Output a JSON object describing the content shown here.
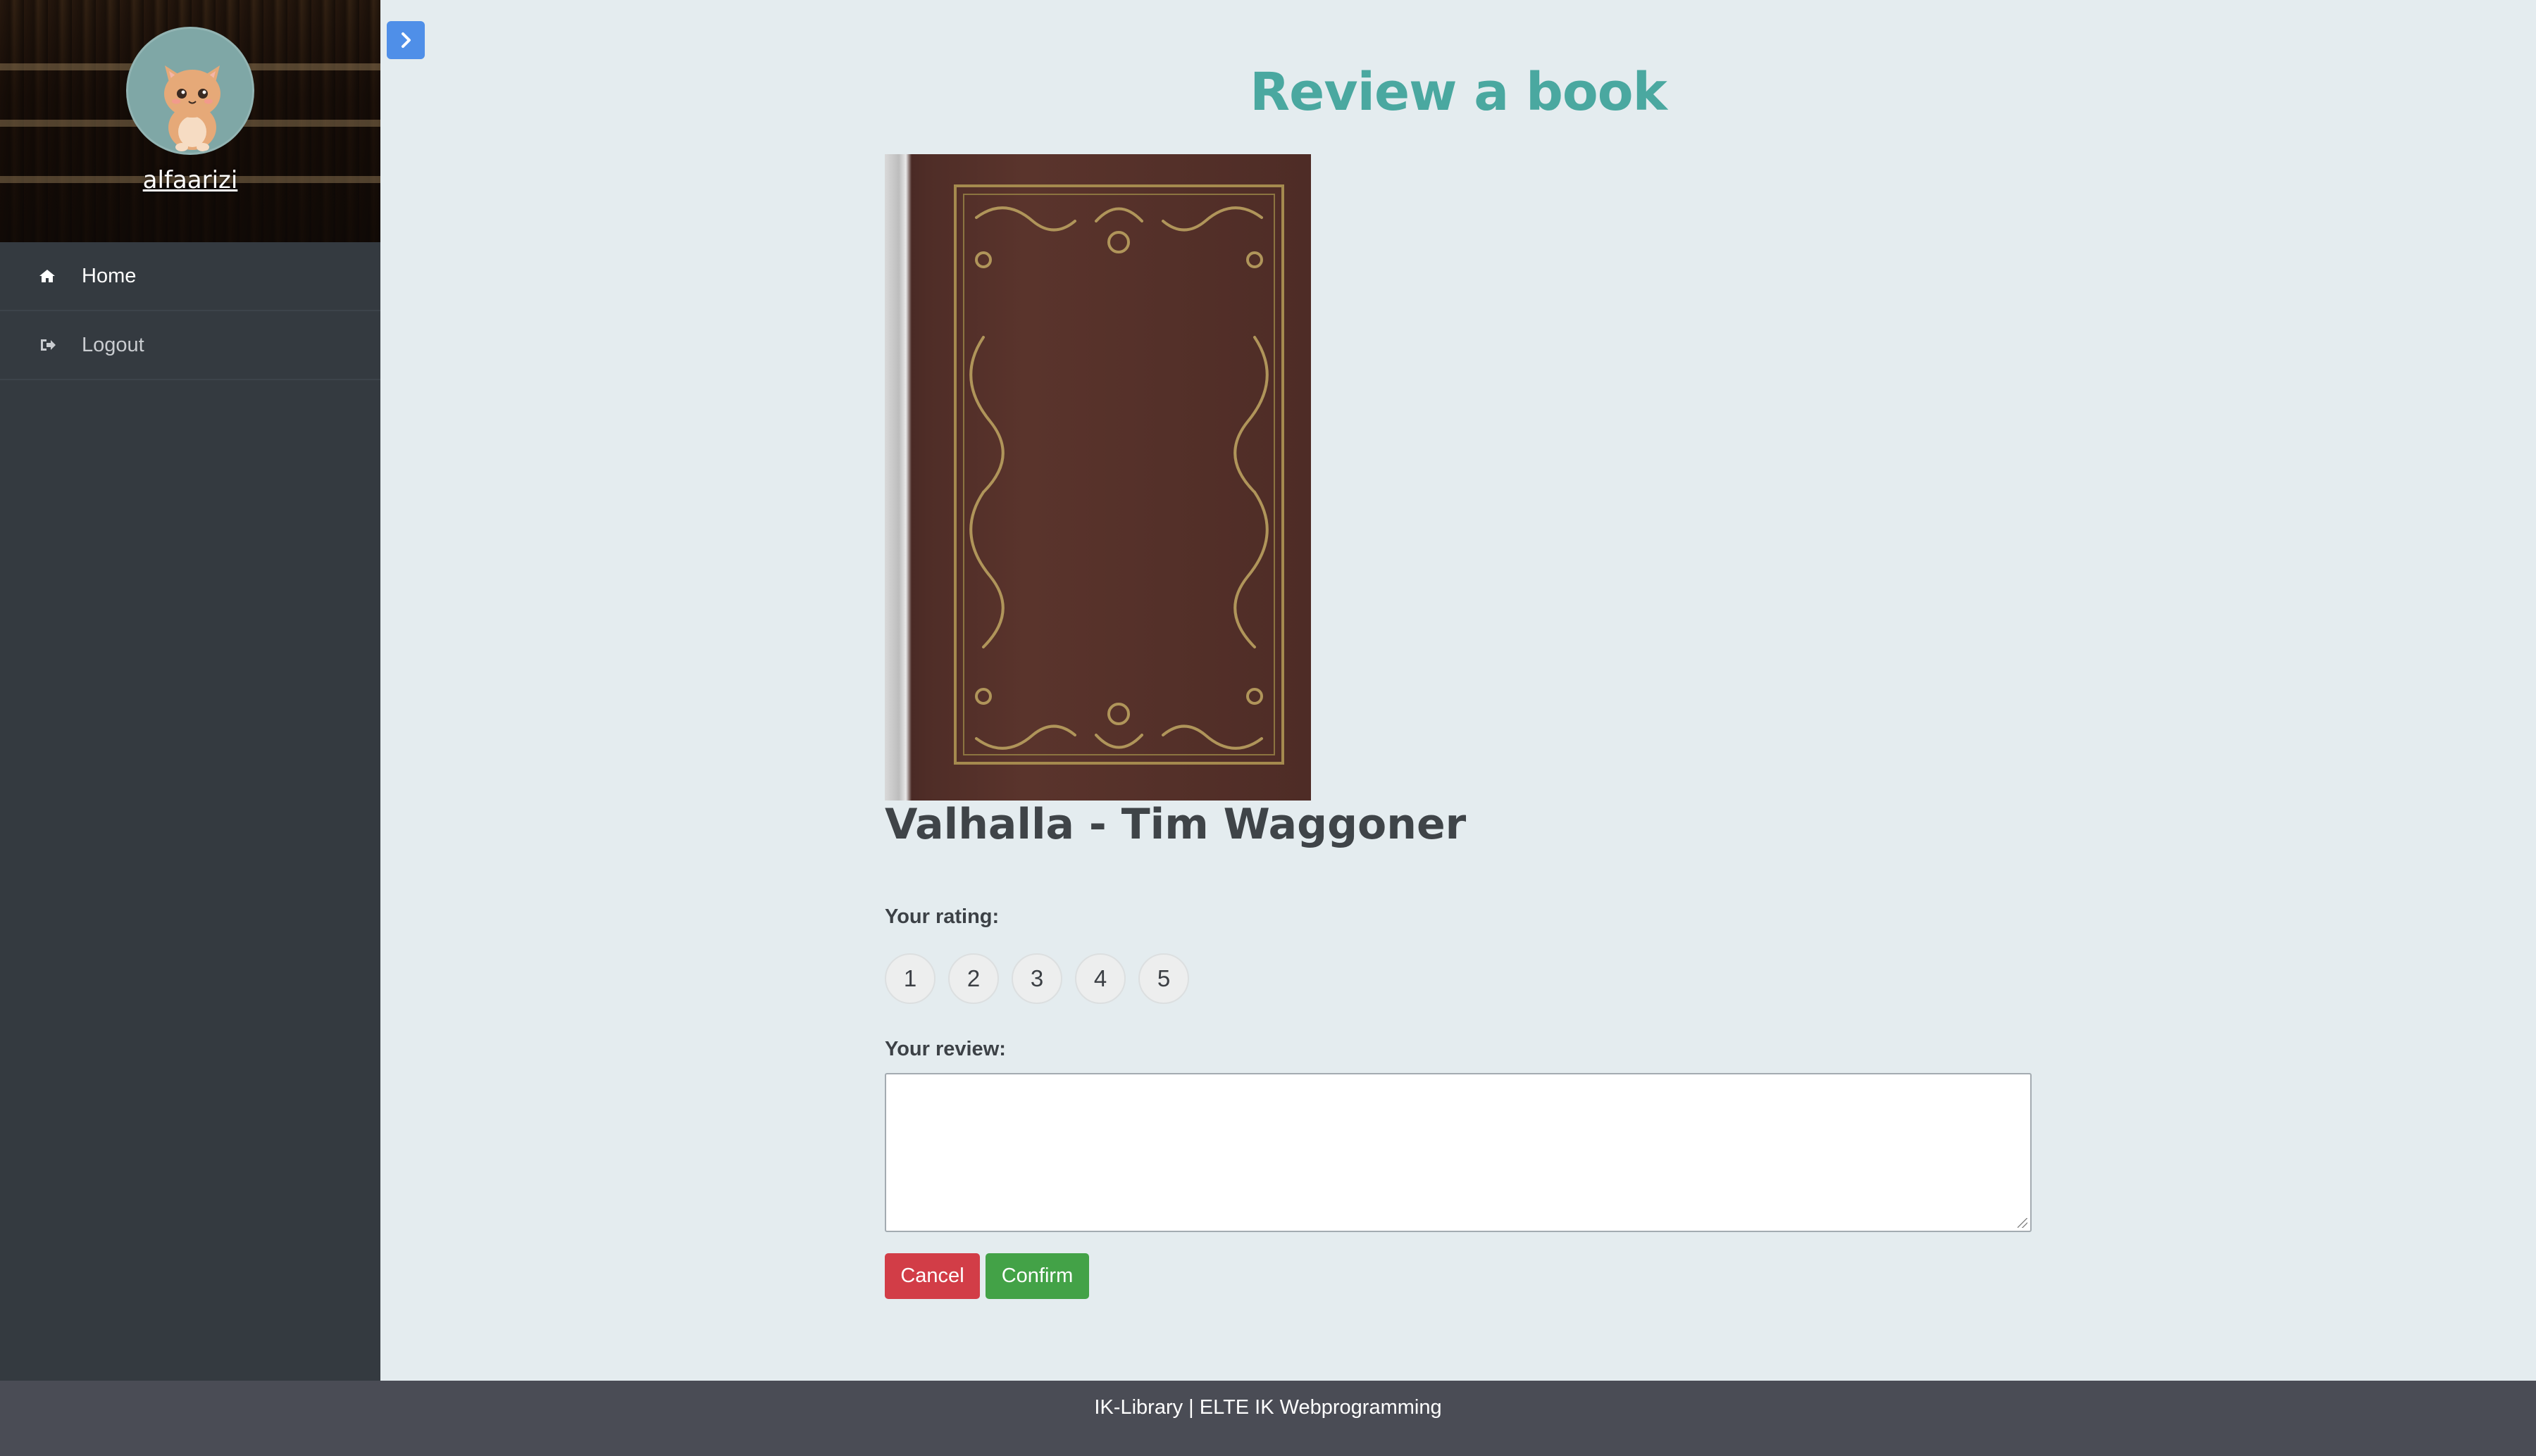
{
  "sidebar": {
    "username": "alfaarizi",
    "items": [
      {
        "label": "Home",
        "icon": "home-icon"
      },
      {
        "label": "Logout",
        "icon": "logout-icon"
      }
    ]
  },
  "header": {
    "toggle_icon": "chevron-right-icon"
  },
  "main": {
    "title": "Review a book",
    "book_title": "Valhalla - Tim Waggoner",
    "rating_label": "Your rating:",
    "rating_options": [
      "1",
      "2",
      "3",
      "4",
      "5"
    ],
    "review_label": "Your review:",
    "review_value": "",
    "cancel_label": "Cancel",
    "confirm_label": "Confirm"
  },
  "footer": {
    "text": "IK-Library | ELTE IK Webprogramming"
  },
  "colors": {
    "accent_title": "#4aa8a0",
    "sidebar_bg": "#343a40",
    "toggle_bg": "#4f8fe8",
    "cancel_bg": "#d23d47",
    "confirm_bg": "#43a247",
    "footer_bg": "#4a4c55",
    "page_bg": "#e4ecef"
  }
}
